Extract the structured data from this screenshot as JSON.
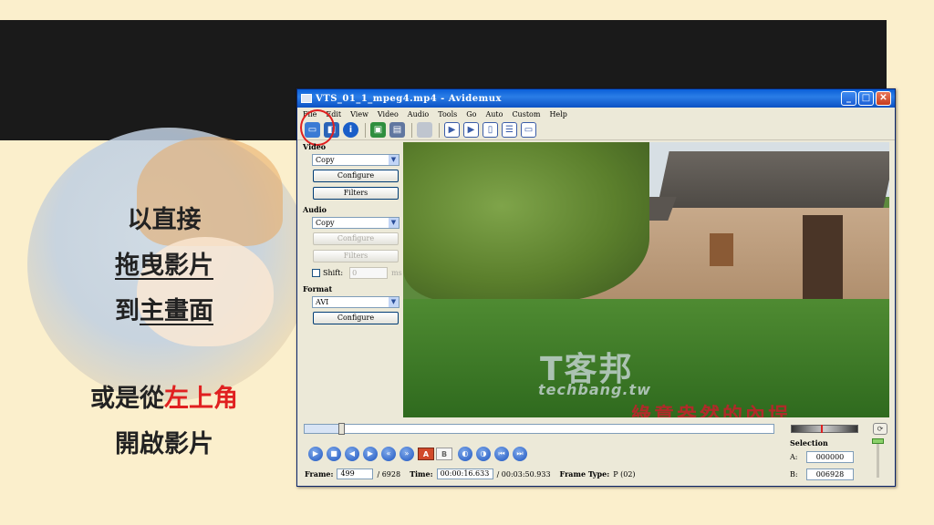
{
  "caption": {
    "line1": "以直接",
    "line2": "拖曳影片",
    "line3_prefix": "到",
    "line3_underlined": "主畫面",
    "line4_prefix": "或是從",
    "line4_red": "左上角",
    "line5": "開啟影片"
  },
  "window": {
    "title": "VTS_01_1_mpeg4.mp4 - Avidemux",
    "controls": {
      "minimize": "_",
      "maximize": "□",
      "close": "✕"
    }
  },
  "menu": [
    "File",
    "Edit",
    "View",
    "Video",
    "Audio",
    "Tools",
    "Go",
    "Auto",
    "Custom",
    "Help"
  ],
  "toolbar_icons": [
    "open-icon",
    "save-icon",
    "info-icon",
    "image-icon",
    "calculator-icon",
    "document-icon",
    "view-input-icon",
    "view-output-icon",
    "view-side-icon",
    "view-top-icon",
    "view-single-icon"
  ],
  "video_panel": {
    "label": "Video",
    "codec": "Copy",
    "configure": "Configure",
    "filters": "Filters"
  },
  "audio_panel": {
    "label": "Audio",
    "codec": "Copy",
    "configure": "Configure",
    "filters": "Filters",
    "shift_label": "Shift:",
    "shift_value": "0",
    "shift_unit": "ms"
  },
  "format_panel": {
    "label": "Format",
    "container": "AVI",
    "configure": "Configure"
  },
  "preview": {
    "watermark": "T客邦",
    "watermark_url": "techbang.tw",
    "subtitle": "綠意盎然的內埕"
  },
  "seek": {
    "position_fraction": 0.072
  },
  "status": {
    "frame_label": "Frame:",
    "frame_value": "499",
    "frame_total": "/ 6928",
    "time_label": "Time:",
    "time_value": "00:00:16.633",
    "time_total": "/ 00:03:50.933",
    "frame_type_label": "Frame Type:",
    "frame_type_value": "P (02)"
  },
  "selection": {
    "title": "Selection",
    "a_label": "A:",
    "a_value": "000000",
    "b_label": "B:",
    "b_value": "006928"
  },
  "marker_buttons": {
    "a": "A",
    "b": "B"
  }
}
